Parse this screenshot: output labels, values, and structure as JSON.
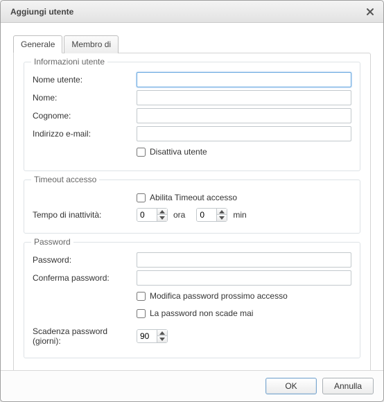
{
  "window": {
    "title": "Aggiungi utente"
  },
  "tabs": {
    "generale": "Generale",
    "membro_di": "Membro di",
    "active": "generale"
  },
  "groups": {
    "user_info": {
      "legend": "Informazioni utente",
      "username_label": "Nome utente:",
      "username_value": "",
      "firstname_label": "Nome:",
      "firstname_value": "",
      "lastname_label": "Cognome:",
      "lastname_value": "",
      "email_label": "Indirizzo e-mail:",
      "email_value": "",
      "disable_user_label": "Disattiva utente",
      "disable_user_checked": false
    },
    "timeout": {
      "legend": "Timeout accesso",
      "enable_label": "Abilita Timeout accesso",
      "enable_checked": false,
      "idle_label": "Tempo di inattività:",
      "hours_value": "0",
      "hours_unit": "ora",
      "minutes_value": "0",
      "minutes_unit": "min"
    },
    "password": {
      "legend": "Password",
      "password_label": "Password:",
      "password_value": "",
      "confirm_label": "Conferma password:",
      "confirm_value": "",
      "change_next_label": "Modifica password prossimo accesso",
      "change_next_checked": false,
      "never_expire_label": "La password non scade mai",
      "never_expire_checked": false,
      "expiry_label": "Scadenza password (giorni):",
      "expiry_value": "90"
    }
  },
  "footer": {
    "ok": "OK",
    "cancel": "Annulla"
  }
}
